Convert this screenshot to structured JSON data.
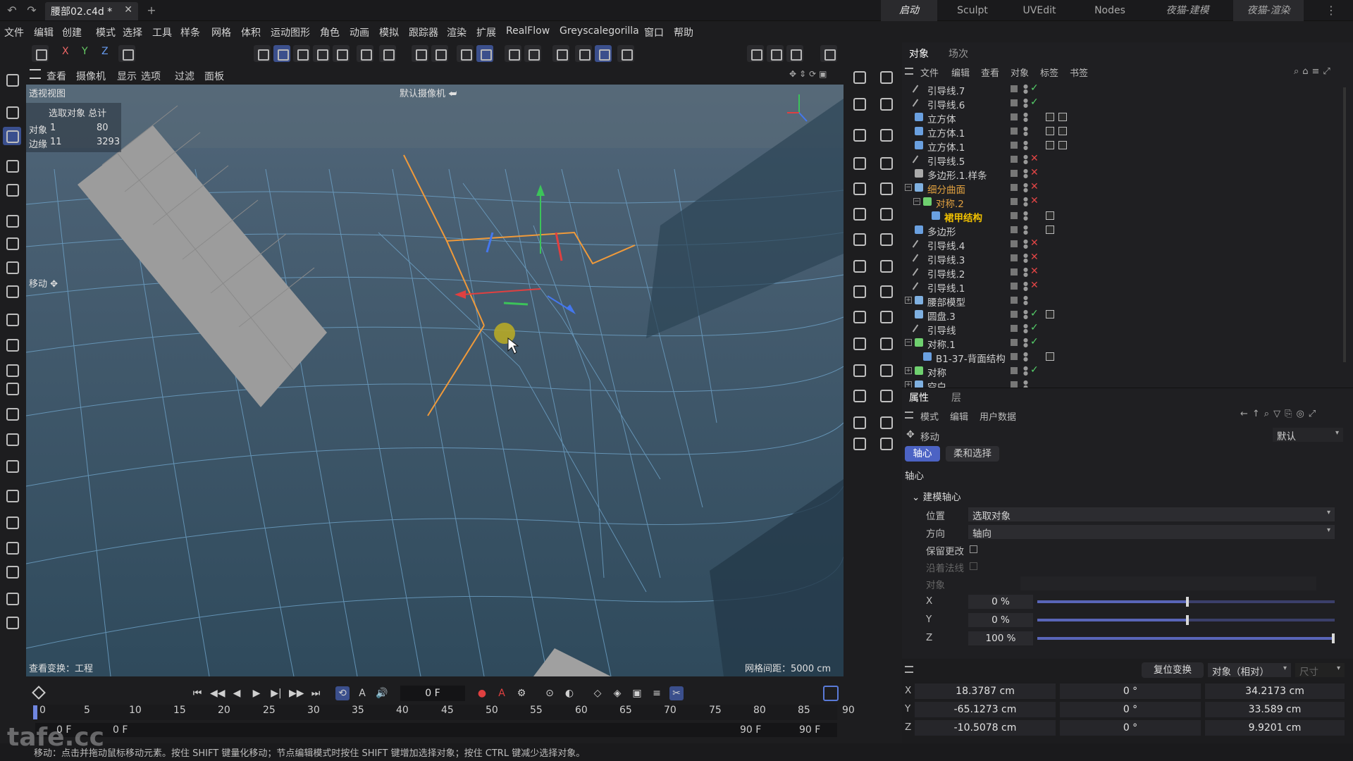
{
  "titlebar": {
    "doc_tab": "腰部02.c4d *",
    "layout_tabs": [
      "启动",
      "Sculpt",
      "UVEdit",
      "Nodes",
      "夜猫-建模",
      "夜猫-渲染"
    ]
  },
  "menubar": [
    "文件",
    "编辑",
    "创建",
    "模式",
    "选择",
    "工具",
    "样条",
    "网格",
    "体积",
    "运动图形",
    "角色",
    "动画",
    "模拟",
    "跟踪器",
    "渲染",
    "扩展",
    "RealFlow",
    "Greyscalegorilla",
    "窗口",
    "帮助"
  ],
  "toolbar": {
    "axis_x": "X",
    "axis_y": "Y",
    "axis_z": "Z"
  },
  "viewport": {
    "menu": [
      "查看",
      "摄像机",
      "显示",
      "选项",
      "过滤",
      "面板"
    ],
    "title": "透视视图",
    "camera": "默认摄像机",
    "stats": {
      "header": "选取对象 总计",
      "rows": [
        {
          "label": "对象",
          "selected": "1",
          "total": "80"
        },
        {
          "label": "边缘",
          "selected": "11",
          "total": "3293"
        }
      ]
    },
    "tool_label": "移动",
    "view_transform": "查看变换：工程",
    "grid_spacing": "网格间距：5000 cm"
  },
  "timeline": {
    "current_frame": "0 F",
    "ticks": [
      "0",
      "5",
      "10",
      "15",
      "20",
      "25",
      "30",
      "35",
      "40",
      "45",
      "50",
      "55",
      "60",
      "65",
      "70",
      "75",
      "80",
      "85",
      "90"
    ],
    "start": "0 F",
    "start2": "0 F",
    "end": "90 F",
    "end2": "90 F"
  },
  "statusbar": "移动：点击并拖动鼠标移动元素。按住 SHIFT 键量化移动；节点编辑模式时按住 SHIFT 键增加选择对象；按住 CTRL 键减少选择对象。",
  "watermark": "tafe.cc",
  "objects_panel": {
    "tabs": [
      "对象",
      "场次"
    ],
    "menu": [
      "文件",
      "编辑",
      "查看",
      "对象",
      "标签",
      "书签"
    ],
    "items": [
      {
        "name": "引导线.7",
        "status": "ok",
        "type": "line",
        "indent": 0
      },
      {
        "name": "引导线.6",
        "status": "ok",
        "type": "line",
        "indent": 0
      },
      {
        "name": "立方体",
        "status": "none",
        "type": "poly",
        "indent": 0
      },
      {
        "name": "立方体.1",
        "status": "none",
        "type": "poly",
        "indent": 0
      },
      {
        "name": "立方体.1",
        "status": "none",
        "type": "poly",
        "indent": 0
      },
      {
        "name": "引导线.5",
        "status": "bad",
        "type": "line",
        "indent": 0
      },
      {
        "name": "多边形.1.样条",
        "status": "bad",
        "type": "spline",
        "indent": 0
      },
      {
        "name": "细分曲面",
        "status": "bad",
        "type": "sds",
        "indent": 0,
        "color": "#e0a040",
        "tree": "minus"
      },
      {
        "name": "对称.2",
        "status": "bad",
        "type": "sym",
        "indent": 1,
        "color": "#e0a040",
        "tree": "minus"
      },
      {
        "name": "裙甲结构",
        "status": "none",
        "type": "poly",
        "indent": 2,
        "color": "#f0c000",
        "bold": true
      },
      {
        "name": "多边形",
        "status": "none",
        "type": "poly",
        "indent": 0
      },
      {
        "name": "引导线.4",
        "status": "bad",
        "type": "line",
        "indent": 0
      },
      {
        "name": "引导线.3",
        "status": "bad",
        "type": "line",
        "indent": 0
      },
      {
        "name": "引导线.2",
        "status": "bad",
        "type": "line",
        "indent": 0
      },
      {
        "name": "引导线.1",
        "status": "bad",
        "type": "line",
        "indent": 0
      },
      {
        "name": "腰部模型",
        "status": "none",
        "type": "null",
        "indent": 0,
        "tree": "plus"
      },
      {
        "name": "圆盘.3",
        "status": "ok",
        "type": "disc",
        "indent": 0
      },
      {
        "name": "引导线",
        "status": "ok",
        "type": "line",
        "indent": 0
      },
      {
        "name": "对称.1",
        "status": "ok",
        "type": "sym",
        "indent": 0,
        "tree": "minus"
      },
      {
        "name": "B1-37-背面结构",
        "status": "none",
        "type": "poly",
        "indent": 1
      },
      {
        "name": "对称",
        "status": "ok",
        "type": "sym",
        "indent": 0,
        "tree": "plus"
      },
      {
        "name": "空白",
        "status": "none",
        "type": "null",
        "indent": 0,
        "tree": "plus"
      }
    ]
  },
  "attributes": {
    "tabs": [
      "属性",
      "层"
    ],
    "menu": [
      "模式",
      "编辑",
      "用户数据"
    ],
    "tool": "移动",
    "preset": "默认",
    "chips": [
      "轴心",
      "柔和选择"
    ],
    "section": "轴心",
    "group": "建模轴心",
    "position_label": "位置",
    "position_value": "选取对象",
    "direction_label": "方向",
    "direction_value": "轴向",
    "keep_changes": "保留更改",
    "along_normal": "沿着法线",
    "object_label": "对象",
    "xyz": [
      {
        "axis": "X",
        "value": "0 %",
        "fraction": 0.5
      },
      {
        "axis": "Y",
        "value": "0 %",
        "fraction": 0.5
      },
      {
        "axis": "Z",
        "value": "100 %",
        "fraction": 1.0
      }
    ]
  },
  "coords": {
    "reset_button": "复位变换",
    "mode": "对象（相对）",
    "size_label": "尺寸",
    "rows": [
      {
        "axis": "X",
        "pos": "18.3787 cm",
        "rot": "0 °",
        "size": "34.2173 cm"
      },
      {
        "axis": "Y",
        "pos": "-65.1273 cm",
        "rot": "0 °",
        "size": "33.589 cm"
      },
      {
        "axis": "Z",
        "pos": "-10.5078 cm",
        "rot": "0 °",
        "size": "9.9201 cm"
      }
    ]
  }
}
